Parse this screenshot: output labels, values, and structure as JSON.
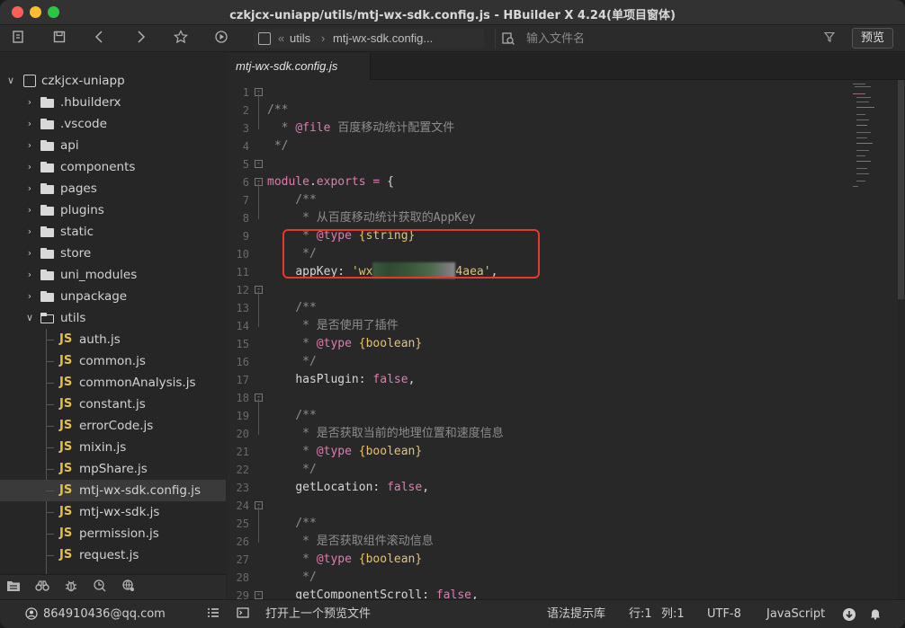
{
  "window": {
    "title": "czkjcx-uniapp/utils/mtj-wx-sdk.config.js - HBuilder X 4.24(单项目窗体)"
  },
  "toolbar": {
    "breadcrumb": [
      "utils",
      "mtj-wx-sdk.config..."
    ],
    "file_search_placeholder": "输入文件名",
    "preview_label": "预览"
  },
  "sidebar": {
    "project": "czkjcx-uniapp",
    "folders": [
      ".hbuilderx",
      ".vscode",
      "api",
      "components",
      "pages",
      "plugins",
      "static",
      "store",
      "uni_modules",
      "unpackage"
    ],
    "open_folder": "utils",
    "files": [
      "auth.js",
      "common.js",
      "commonAnalysis.js",
      "constant.js",
      "errorCode.js",
      "mixin.js",
      "mpShare.js",
      "mtj-wx-sdk.config.js",
      "mtj-wx-sdk.js",
      "permission.js",
      "request.js"
    ],
    "selected_file": "mtj-wx-sdk.config.js",
    "js_badge": "JS"
  },
  "editor": {
    "tab_label": "mtj-wx-sdk.config.js",
    "line_numbers": [
      "1",
      "2",
      "3",
      "4",
      "5",
      "6",
      "7",
      "8",
      "9",
      "10",
      "11",
      "12",
      "13",
      "14",
      "15",
      "16",
      "17",
      "18",
      "19",
      "20",
      "21",
      "22",
      "23",
      "24",
      "25",
      "26",
      "27",
      "28",
      "29"
    ],
    "lines": {
      "l1": "/**",
      "l2_tag": "@file",
      "l2_text": " 百度移动统计配置文件",
      "l3": " */",
      "l5_module": "module",
      "l5_exports": "exports",
      "l7_text": "从百度移动统计获取的AppKey",
      "l8_tag": "@type",
      "l8_type": "{string}",
      "l10_key": "appKey",
      "l10_str_start": "'wx",
      "l10_str_end": "4aea'",
      "l13_text": "是否使用了插件",
      "l14_type": "{boolean}",
      "l16_key": "hasPlugin",
      "l16_val": "false",
      "l19_text": "是否获取当前的地理位置和速度信息",
      "l20_type": "{boolean}",
      "l22_key": "getLocation",
      "l22_val": "false",
      "l25_text": "是否获取组件滚动信息",
      "l26_type": "{boolean}",
      "l28_key": "getComponentScroll",
      "l28_val": "false"
    }
  },
  "statusbar": {
    "user": "864910436@qq.com",
    "open_last_preview": "打开上一个预览文件",
    "syntax_hint": "语法提示库",
    "row": "行:1",
    "col": "列:1",
    "encoding": "UTF-8",
    "language": "JavaScript"
  }
}
